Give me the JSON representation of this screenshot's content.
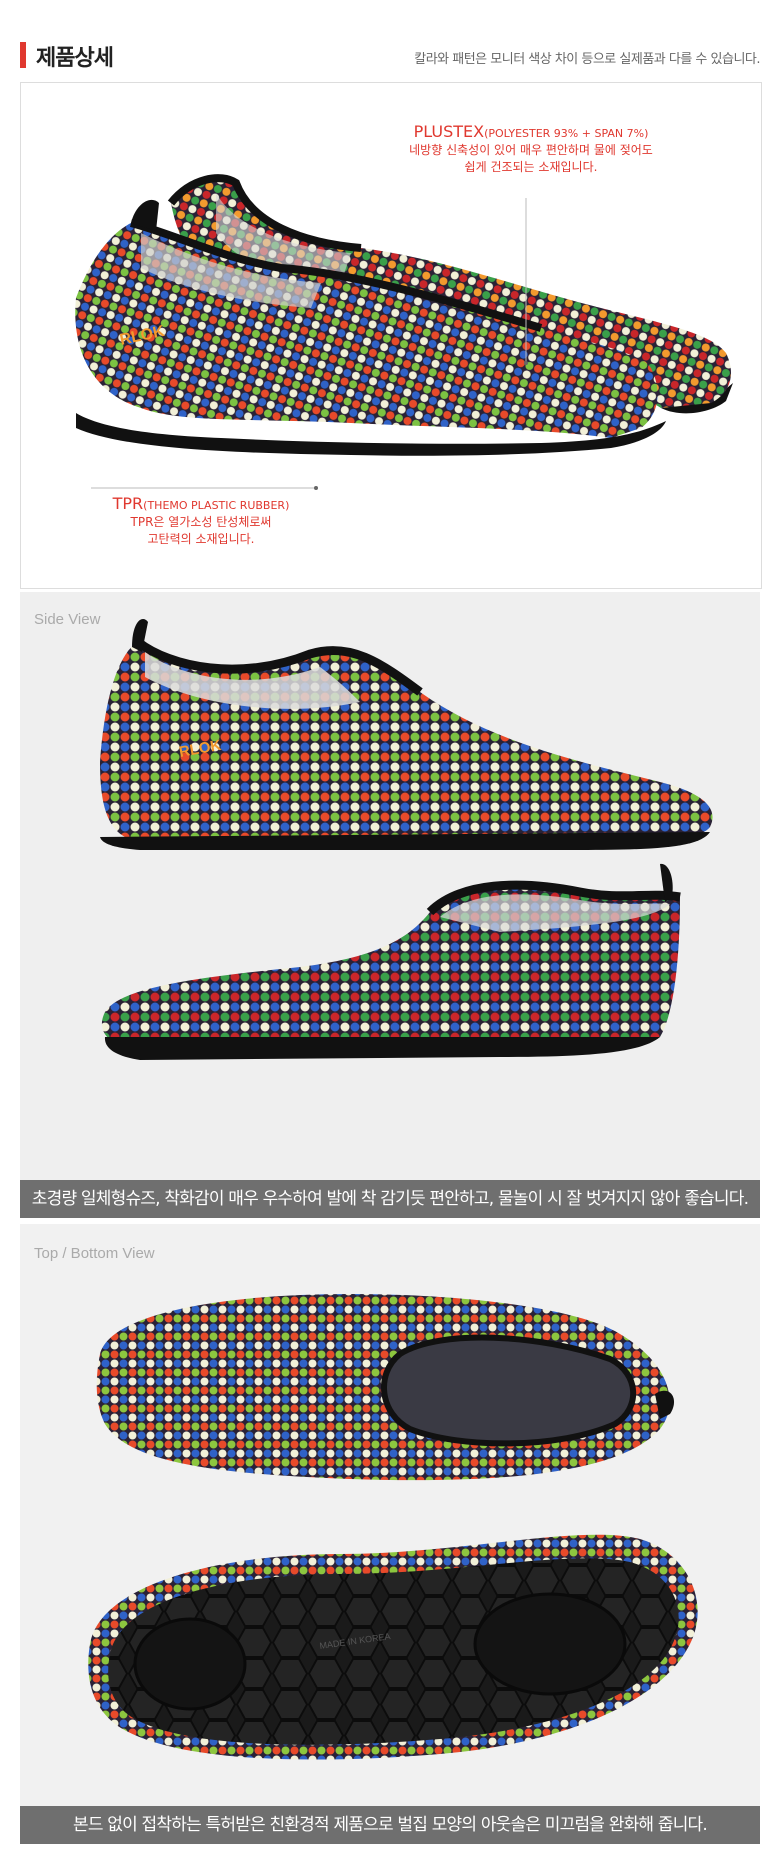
{
  "header": {
    "title": "제품상세",
    "note": "칼라와 패턴은 모니터 색상 차이 등으로 실제품과 다를 수 있습니다."
  },
  "detail": {
    "plustex": {
      "name": "PLUSTEX",
      "spec": "(POLYESTER 93% + SPAN 7%)",
      "line1": "네방향 신축성이 있어 매우 편안하며 물에 젖어도",
      "line2": "쉽게 건조되는 소재입니다."
    },
    "tpr": {
      "name": "TPR",
      "spec": "(THEMO PLASTIC RUBBER)",
      "line1": "TPR은 열가소성 탄성체로써",
      "line2": "고탄력의 소재입니다."
    },
    "logo_text": "RLOK"
  },
  "side_view": {
    "label": "Side View",
    "caption": "초경량 일체형슈즈, 착화감이 매우 우수하여 발에 착 감기듯 편안하고, 물놀이 시 잘 벗겨지지 않아 좋습니다."
  },
  "top_view": {
    "label": "Top / Bottom View",
    "caption": "본드 없이 접착하는 특허받은 친환경적 제품으로 벌집 모양의 아웃솔은 미끄럼을 완화해 줍니다.",
    "sole_text": "MADE IN KOREA"
  },
  "colors": {
    "accent": "#e0382f",
    "dots": [
      "#e84a2a",
      "#7cc242",
      "#2f62c8",
      "#f2f0d8",
      "#3aa04a",
      "#c9262a",
      "#f39a2e",
      "#8dc63f"
    ]
  }
}
